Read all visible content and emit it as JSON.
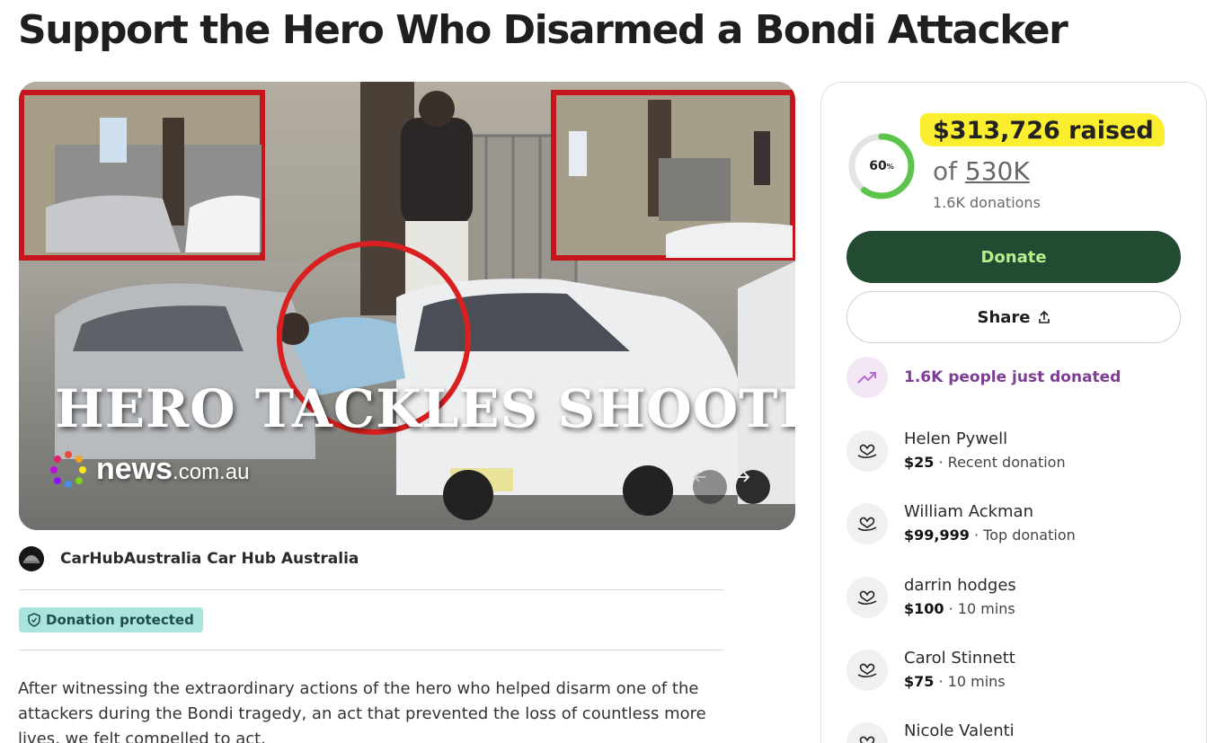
{
  "page": {
    "title": "Support the Hero Who Disarmed a Bondi Attacker"
  },
  "hero_image": {
    "caption": "HERO TACKLES SHOOTER",
    "logo_main": "news",
    "logo_suffix": ".com.au",
    "prev_icon": "arrow-left-icon",
    "next_icon": "arrow-right-icon"
  },
  "organizer": {
    "name": "CarHubAustralia Car Hub Australia"
  },
  "protection": {
    "label": "Donation protected",
    "icon": "shield-icon"
  },
  "story": {
    "text": "After witnessing the extraordinary actions of the hero who helped disarm one of the attackers during the Bondi tragedy, an act that prevented the loss of countless more lives, we felt compelled to act."
  },
  "fundraiser": {
    "percent": 60,
    "percent_label": "60",
    "percent_sign": "%",
    "raised": "$313,726 raised",
    "goal_prefix": "of ",
    "goal": "530K",
    "donations_count": "1.6K donations",
    "donate_label": "Donate",
    "share_label": "Share",
    "trend_text": "1.6K people just donated"
  },
  "donors": [
    {
      "name": "Helen Pywell",
      "amount": "$25",
      "note": " · Recent donation"
    },
    {
      "name": "William Ackman",
      "amount": "$99,999",
      "note": " · Top donation"
    },
    {
      "name": "darrin hodges",
      "amount": "$100",
      "note": " · 10 mins"
    },
    {
      "name": "Carol Stinnett",
      "amount": "$75",
      "note": " · 10 mins"
    },
    {
      "name": "Nicole Valenti",
      "amount": "",
      "note": ""
    }
  ],
  "colors": {
    "donate_bg": "#234b32",
    "donate_text": "#b6f08c",
    "progress": "#5cc44a",
    "highlight": "#fbee2f",
    "trend": "#7d3d94",
    "badge": "#a9e4df"
  }
}
